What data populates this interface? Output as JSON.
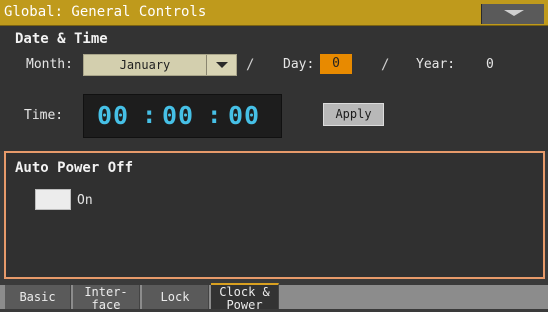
{
  "title_bar": {
    "title": "Global: General Controls",
    "menu_icon": "chevron-down-icon"
  },
  "date_time": {
    "section_title": "Date & Time",
    "month_label": "Month:",
    "month_value": "January",
    "day_label": "Day:",
    "day_value": "0",
    "year_label": "Year:",
    "year_value": "0",
    "separator": "/",
    "time_label": "Time:",
    "hours": "00",
    "minutes": "00",
    "seconds": "00",
    "time_separator": ":",
    "apply_label": "Apply"
  },
  "auto_power_off": {
    "section_title": "Auto Power Off",
    "checkbox_label": "On",
    "checked": false
  },
  "tabs": [
    {
      "line1": "Basic",
      "line2": ""
    },
    {
      "line1": "Inter-",
      "line2": "face"
    },
    {
      "line1": "Lock",
      "line2": ""
    },
    {
      "line1": "Clock &",
      "line2": "Power"
    }
  ],
  "colors": {
    "title_bar": "#bf9a1c",
    "day_highlight": "#e88a00",
    "time_digits": "#46c0e6",
    "selected_panel_border": "#e79a6a"
  }
}
